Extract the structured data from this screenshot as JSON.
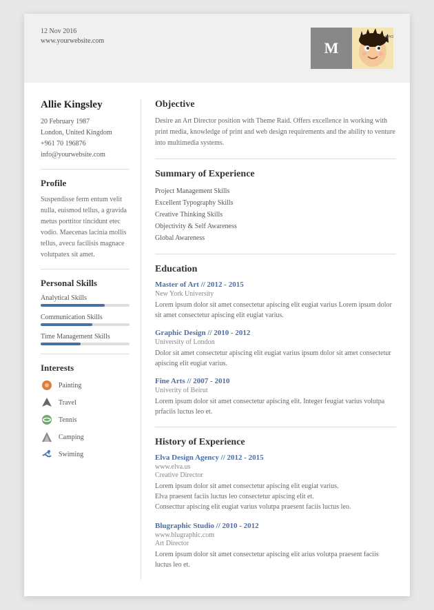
{
  "header": {
    "date": "12 Nov 2016",
    "website": "www.yourwebsite.com",
    "photo_initial": "M"
  },
  "left": {
    "name": "Allie Kingsley",
    "contact": {
      "dob": "20 February 1987",
      "location": "London, United Kingdom",
      "phone": "+961 70 196876",
      "email": "info@yourwebsite.com"
    },
    "profile_title": "Profile",
    "profile_text": "Suspendisse ferm entum velit nulla, euismod tellus, a gravida metus porttitor tincidunt etec vodio. Maecenas lacinia mollis tellus, avecu facilisis magnace volutpatex sit amet.",
    "skills_title": "Personal Skills",
    "skills": [
      {
        "label": "Analytical Skills",
        "percent": 72
      },
      {
        "label": "Communication Skills",
        "percent": 58
      },
      {
        "label": "Time Management Skills",
        "percent": 45
      }
    ],
    "interests_title": "Interests",
    "interests": [
      {
        "label": "Painting",
        "icon": "painting"
      },
      {
        "label": "Travel",
        "icon": "travel"
      },
      {
        "label": "Tennis",
        "icon": "tennis"
      },
      {
        "label": "Camping",
        "icon": "camping"
      },
      {
        "label": "Swiming",
        "icon": "swimming"
      }
    ]
  },
  "right": {
    "objective_title": "Objective",
    "objective_text": "Desire an Art Director position with Theme Raid. Offers excellence in working with print media, knowledge of print and web design requirements and the ability to venture into multimedia systems.",
    "summary_title": "Summary of Experience",
    "summary_items": [
      "Project Management Skills",
      "Excellent Typography Skills",
      "Creative Thinking Skills",
      "Objectivity & Self Awareness",
      "Global Awareness"
    ],
    "education_title": "Education",
    "education": [
      {
        "title": "Master of Art // 2012 - 2015",
        "school": "New York University",
        "desc": "Lorem ipsum dolor sit amet consectetur apiscing elit eugiat varius Lorem ipsum dolor sit amet consectetur apiscing elit eugiat varius."
      },
      {
        "title": "Graphic Design // 2010 - 2012",
        "school": "University of London",
        "desc": "Dolor sit amet consectetur apiscing elit eugiat varius  ipsum dolor sit amet consectetur apiscing elit eugiat varius."
      },
      {
        "title": "Fine Arts // 2007 - 2010",
        "school": "Univerity of Beirut",
        "desc": "Lorem ipsum dolor sit amet consectetur apiscing elit. Integer feugiat varius volutpa prfaciis luctus leo et."
      }
    ],
    "experience_title": "History of Experience",
    "experience": [
      {
        "title": "Elva Design Agency // 2012 - 2015",
        "website": "www.elva.us",
        "role": "Creative Director",
        "desc": "Lorem ipsum dolor sit amet consectetur apiscing elit eugiat varius.\nElva praesent faciis luctus leo consectetur apiscing elit et.\nConsecttur apiscing elit eugiat varius volutpa praesent faciis luctus leo."
      },
      {
        "title": "Blugraphic Studio // 2010 - 2012",
        "website": "www.blugraphic.com",
        "role": "Art Director",
        "desc": "Lorem ipsum dolor sit amet consectetur apiscing elit arius volutpa praesent faciis luctus leo et."
      }
    ]
  }
}
